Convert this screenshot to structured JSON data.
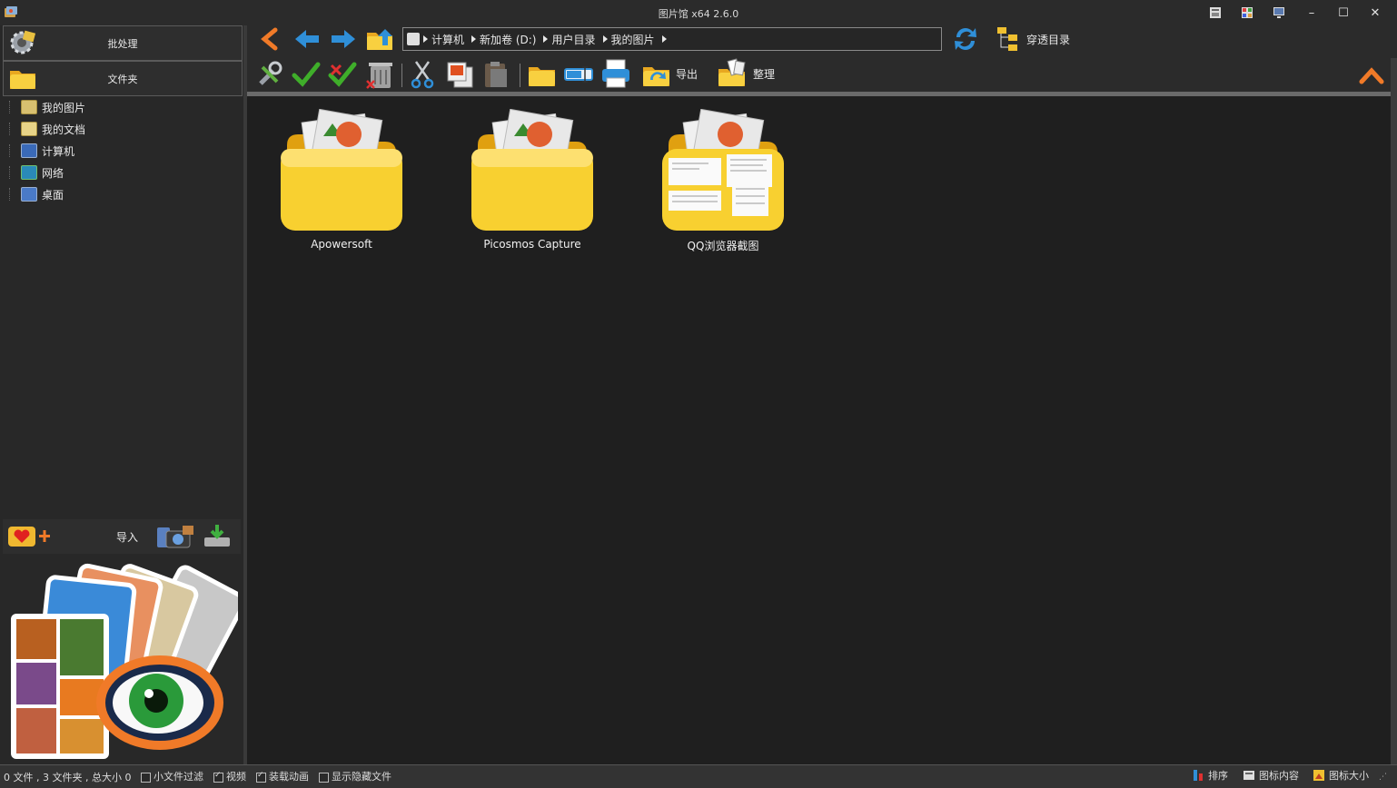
{
  "window": {
    "title": "图片馆 x64 2.6.0"
  },
  "left_panel": {
    "batch_label": "批处理",
    "folder_label": "文件夹",
    "tree": [
      {
        "label": "我的图片",
        "icon": "pictures-folder-icon"
      },
      {
        "label": "我的文档",
        "icon": "documents-folder-icon"
      },
      {
        "label": "计算机",
        "icon": "computer-icon"
      },
      {
        "label": "网络",
        "icon": "network-icon"
      },
      {
        "label": "桌面",
        "icon": "desktop-icon"
      }
    ],
    "import_label": "导入"
  },
  "navbar": {
    "breadcrumb": [
      "计算机",
      "新加卷 (D:)",
      "用户目录",
      "我的图片"
    ],
    "through_dir_label": "穿透目录"
  },
  "toolbar": {
    "export_label": "导出",
    "organize_label": "整理"
  },
  "folders": [
    {
      "name": "Apowersoft"
    },
    {
      "name": "Picosmos Capture"
    },
    {
      "name": "QQ浏览器截图"
    }
  ],
  "statusbar": {
    "summary": "0 文件 , 3 文件夹 , 总大小 0",
    "small_file_filter": "小文件过滤",
    "video": "视频",
    "load_animation": "装载动画",
    "show_hidden": "显示隐藏文件",
    "sort": "排序",
    "icon_content": "图标内容",
    "icon_size": "图标大小",
    "checks": {
      "small_file_filter": false,
      "video": true,
      "load_animation": true,
      "show_hidden": false
    }
  },
  "colors": {
    "accent_orange": "#f07a28",
    "accent_blue": "#2f8fd8",
    "folder_yellow": "#f5c42a",
    "check_green": "#3fae2a"
  }
}
